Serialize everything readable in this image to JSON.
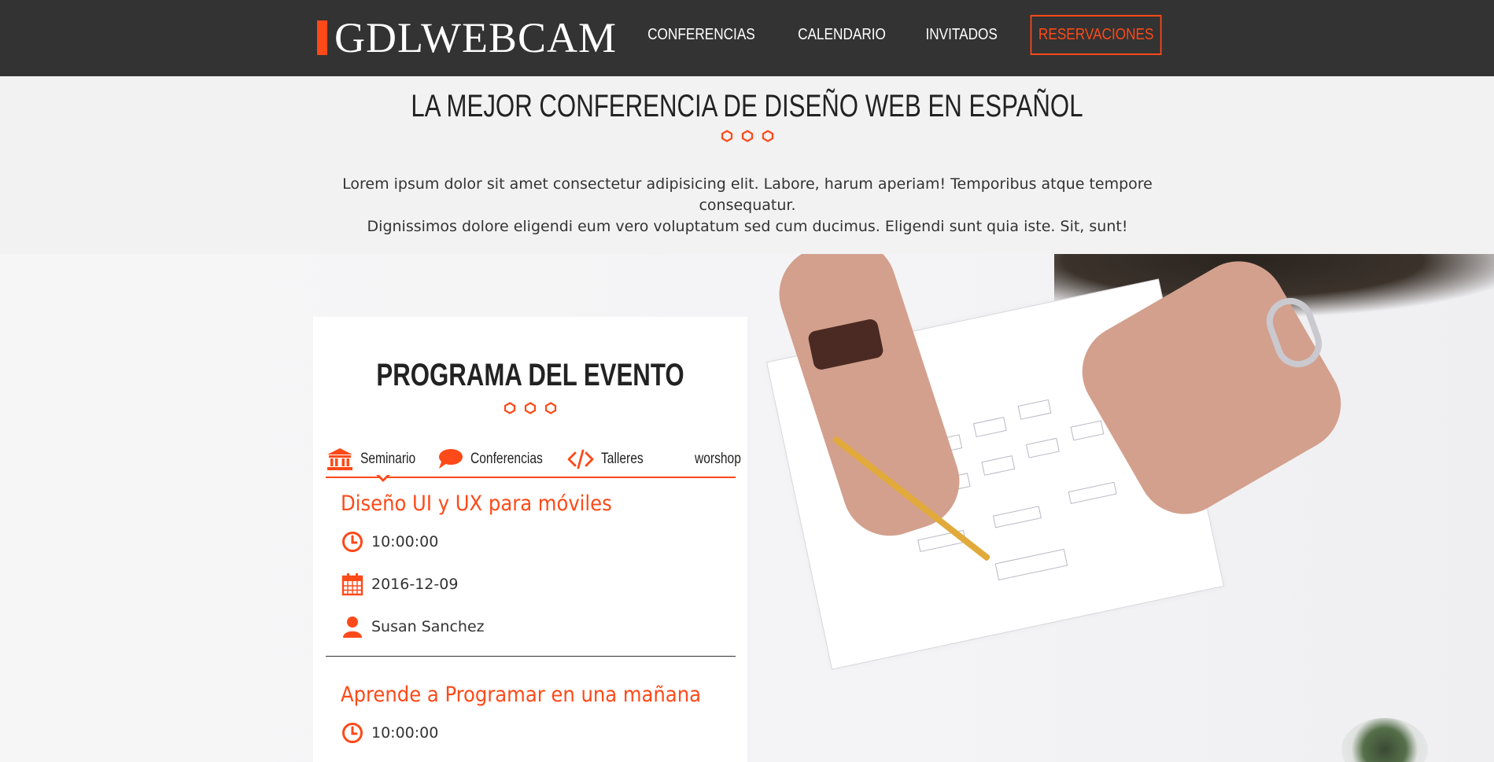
{
  "brand": {
    "name": "GDLWEBCAM",
    "accent": "#fe4918",
    "header_bg": "#333333"
  },
  "nav": {
    "items": [
      {
        "label": "CONFERENCIAS"
      },
      {
        "label": "CALENDARIO"
      },
      {
        "label": "INVITADOS"
      },
      {
        "label": "RESERVACIONES"
      }
    ]
  },
  "intro": {
    "title": "LA MEJOR CONFERENCIA DE DISEÑO WEB EN ESPAÑOL",
    "text_line1": "Lorem ipsum dolor sit amet consectetur adipisicing elit. Labore, harum aperiam! Temporibus atque tempore consequatur.",
    "text_line2": "Dignissimos dolore eligendi eum vero voluptatum sed cum ducimus. Eligendi sunt quia iste. Sit, sunt!"
  },
  "program": {
    "title": "PROGRAMA DEL EVENTO",
    "tabs": [
      {
        "label": "Seminario",
        "icon": "university-icon"
      },
      {
        "label": "Conferencias",
        "icon": "comment-icon"
      },
      {
        "label": "Talleres",
        "icon": "code-icon"
      },
      {
        "label": "worshop",
        "icon": ""
      }
    ],
    "events": [
      {
        "title": "Diseño UI y UX para móviles",
        "time": "10:00:00",
        "date": "2016-12-09",
        "speaker": "Susan Sanchez"
      },
      {
        "title": "Aprende a Programar en una mañana",
        "time": "10:00:00"
      }
    ]
  }
}
